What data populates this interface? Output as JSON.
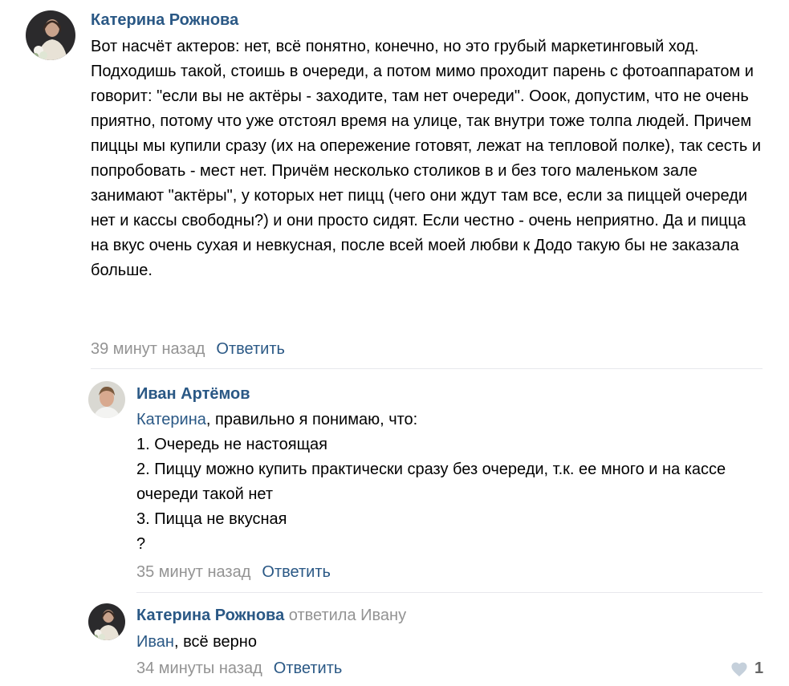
{
  "comments": [
    {
      "author": "Катерина Рожнова",
      "text": "Вот насчёт актеров: нет, всё понятно, конечно, но это грубый маркетинговый ход. Подходишь такой, стоишь в очереди, а потом мимо проходит парень с фотоаппаратом и говорит: \"если вы не актёры - заходите, там нет очереди\". Ооок, допустим, что не очень приятно, потому что уже отстоял время на улице, так внутри тоже толпа людей. Причем пиццы мы купили сразу (их на опережение готовят, лежат на тепловой полке), так сесть и попробовать - мест нет. Причём несколько столиков в и без того маленьком зале занимают \"актёры\", у которых нет пицц (чего они ждут там все, если за пиццей очереди нет и кассы свободны?) и они просто сидят. Если честно - очень неприятно. Да и пицца на вкус очень сухая и невкусная, после всей моей любви к Додо такую бы не заказала больше.",
      "time": "39 минут назад",
      "reply_label": "Ответить"
    },
    {
      "author": "Иван Артёмов",
      "mention": "Катерина",
      "first_line_rest": ", правильно я понимаю, что:",
      "lines": [
        "1. Очередь не настоящая",
        "2. Пиццу можно купить практически сразу без очереди, т.к. ее много и на кассе очереди такой нет",
        "3. Пицца не вкусная",
        "?"
      ],
      "time": "35 минут назад",
      "reply_label": "Ответить"
    },
    {
      "author": "Катерина Рожнова",
      "replied_to": "ответила Ивану",
      "mention": "Иван",
      "text_rest": ", всё верно",
      "time": "34 минуты назад",
      "reply_label": "Ответить",
      "likes": "1"
    }
  ],
  "colors": {
    "link": "#2a5885",
    "meta": "#939393",
    "divider": "#e7e8ec"
  }
}
